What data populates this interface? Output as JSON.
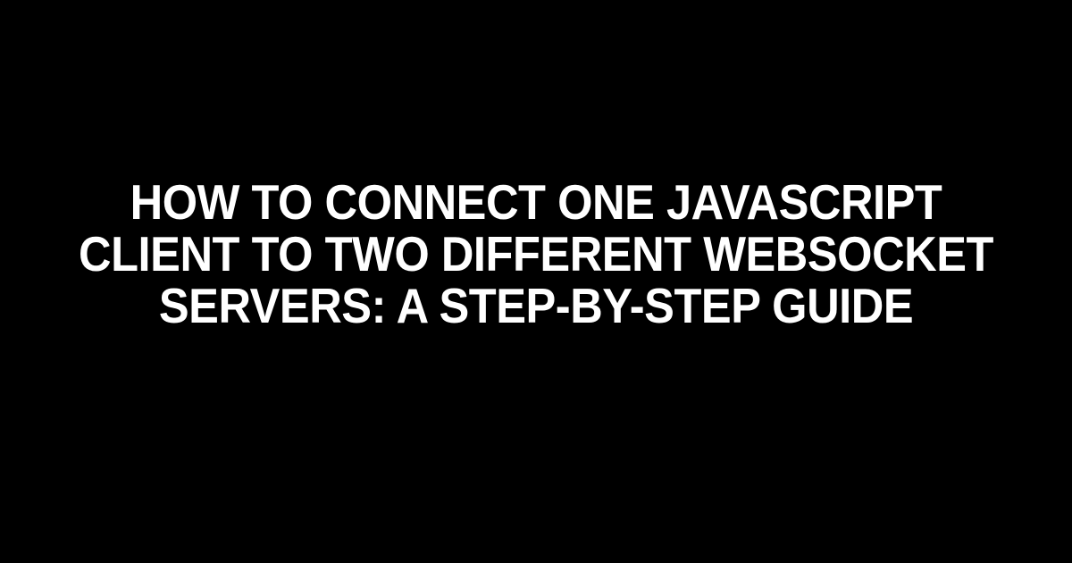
{
  "headline": "HOW TO CONNECT ONE JAVASCRIPT CLIENT TO TWO DIFFERENT WEBSOCKET SERVERS: A STEP-BY-STEP GUIDE"
}
